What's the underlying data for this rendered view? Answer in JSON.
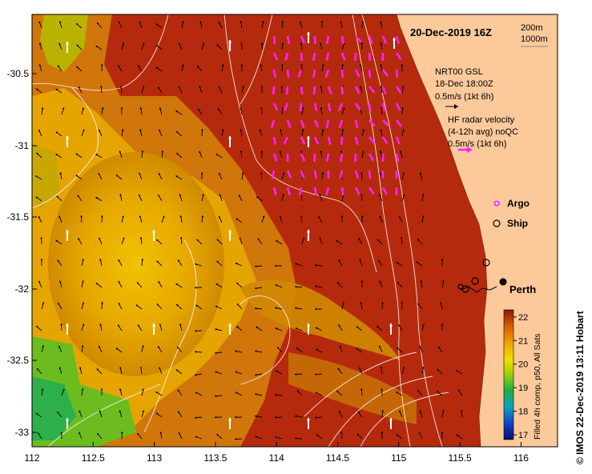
{
  "title": "20-Dec-2019 16Z",
  "scale_labels": [
    "200m",
    "1000m"
  ],
  "model": {
    "line1": "NRT00 GSL",
    "line2": "18-Dec 18:00Z",
    "line3": "0.5m/s (1kt 6h)"
  },
  "hf_radar": {
    "line1": "HF radar velocity",
    "line2": "(4-12h avg) noQC",
    "line3": "0.5m/s (1kt 6h)"
  },
  "legend": {
    "argo": "Argo",
    "ship": "Ship"
  },
  "city": "Perth",
  "colorbar": {
    "label": "Filled 4h comp, p50, All Sats",
    "ticks": [
      "22",
      "21",
      "20",
      "19",
      "18",
      "17"
    ],
    "min": 16.8,
    "max": 22.3
  },
  "x_ticks": [
    "112",
    "112.5",
    "113",
    "113.5",
    "114",
    "114.5",
    "115",
    "115.5",
    "116"
  ],
  "y_ticks": [
    "-30.5",
    "-31",
    "-31.5",
    "-32",
    "-32.5",
    "-33"
  ],
  "credit": "© IMOS 22-Dec-2019 13:11 Hobart",
  "colors": {
    "land": "#fbc99a",
    "sst_warm": "#b82a0a",
    "sst_mid": "#e8a000",
    "sst_cool": "#2fb23a",
    "hf_arrow": "#ff20ff",
    "model_arrow": "#000000",
    "argo_arrow": "#ffffff"
  }
}
